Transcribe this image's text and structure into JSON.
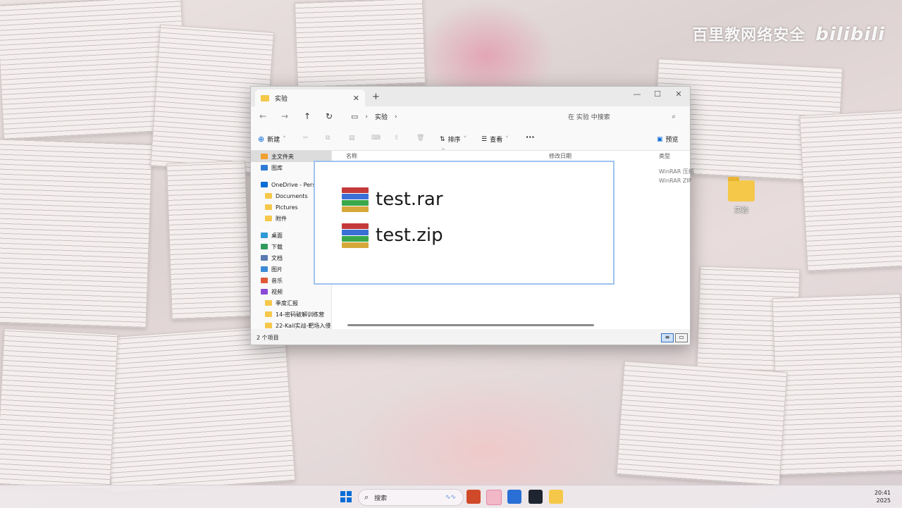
{
  "watermark": {
    "text": "百里教网络安全",
    "logo": "bilibili"
  },
  "desktop": {
    "icon_label": "实验"
  },
  "window": {
    "tab_title": "实验",
    "breadcrumb": "实验",
    "search_placeholder": "在 实验 中搜索",
    "toolbar": {
      "new_label": "新建",
      "sort_label": "排序",
      "view_label": "查看",
      "more_label": "···",
      "preview_label": "预览"
    },
    "sidebar": [
      {
        "label": "主文件夹",
        "icon": "home-icon",
        "color": "#f0a030"
      },
      {
        "label": "图库",
        "icon": "gallery-icon",
        "color": "#2f7ad6"
      },
      {
        "label": "OneDrive - Pers",
        "icon": "cloud-icon",
        "color": "#0a6cd6"
      },
      {
        "label": "Documents",
        "icon": "folder-icon",
        "color": "#f5c84a"
      },
      {
        "label": "Pictures",
        "icon": "folder-icon",
        "color": "#f5c84a"
      },
      {
        "label": "附件",
        "icon": "folder-icon",
        "color": "#f5c84a"
      },
      {
        "label": "桌面",
        "icon": "desktop-icon",
        "color": "#2f9ad6"
      },
      {
        "label": "下载",
        "icon": "download-icon",
        "color": "#2f9a5a"
      },
      {
        "label": "文档",
        "icon": "document-icon",
        "color": "#5a7ab0"
      },
      {
        "label": "图片",
        "icon": "picture-icon",
        "color": "#3a8ad6"
      },
      {
        "label": "音乐",
        "icon": "music-icon",
        "color": "#e05a3a"
      },
      {
        "label": "视频",
        "icon": "video-icon",
        "color": "#8a4ad6"
      },
      {
        "label": "季度汇报",
        "icon": "folder-icon",
        "color": "#f5c84a"
      },
      {
        "label": "14-密码破解训练营",
        "icon": "folder-icon",
        "color": "#f5c84a"
      },
      {
        "label": "22-Kali实战-靶场入侵",
        "icon": "folder-icon",
        "color": "#f5c84a"
      }
    ],
    "columns": {
      "name": "名称",
      "modified": "修改日期",
      "type": "类型"
    },
    "type_values": [
      "WinRAR 压缩",
      "WinRAR ZIP"
    ],
    "status": "2 个项目"
  },
  "zoom": {
    "files": [
      "test.rar",
      "test.zip"
    ]
  },
  "taskbar": {
    "search_label": "搜索",
    "time": "20:41",
    "year": "2025"
  }
}
